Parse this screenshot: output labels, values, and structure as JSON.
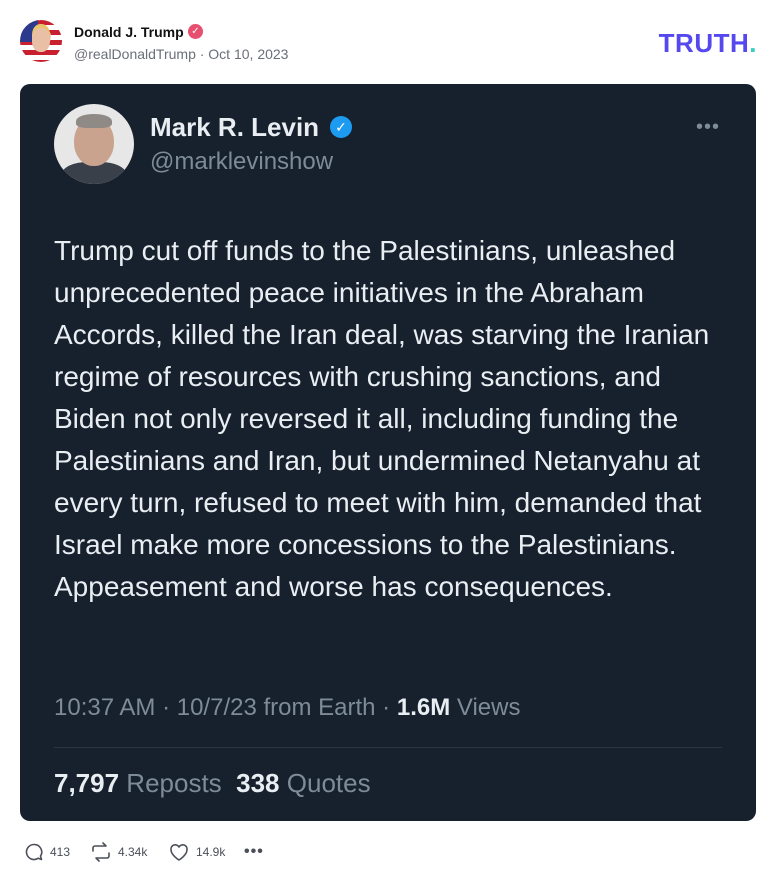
{
  "post": {
    "author_name": "Donald J. Trump",
    "meta": "@realDonaldTrump · Oct 10, 2023",
    "verified_icon": "verified-badge-icon",
    "brand_logo": "TRUTH",
    "brand_logo_dot": ".",
    "brand_color": "#5448ee"
  },
  "tweet": {
    "name": "Mark R. Levin",
    "handle": "@marklevinshow",
    "more": "•••",
    "text": "Trump cut off funds to the Palestinians, unleashed unprecedented peace initiatives in the Abraham Accords, killed the Iran deal, was starving the Iranian regime of resources with crushing sanctions, and Biden not only reversed it all, including funding the Palestinians and Iran, but undermined Netanyahu at every turn, refused to meet with him, demanded that Israel make more concessions to the Palestinians. Appeasement and worse has consequences.",
    "time": "10:37 AM · 10/7/23 from Earth · ",
    "views_count": "1.6M",
    "views_label": " Views",
    "reposts_count": "7,797",
    "reposts_label": " Reposts",
    "quotes_count": "338",
    "quotes_label": " Quotes",
    "background": "#17202d",
    "verified_color": "#1d9bf0"
  },
  "actions": {
    "replies": "413",
    "retruths": "4.34k",
    "likes": "14.9k",
    "more": "•••"
  }
}
